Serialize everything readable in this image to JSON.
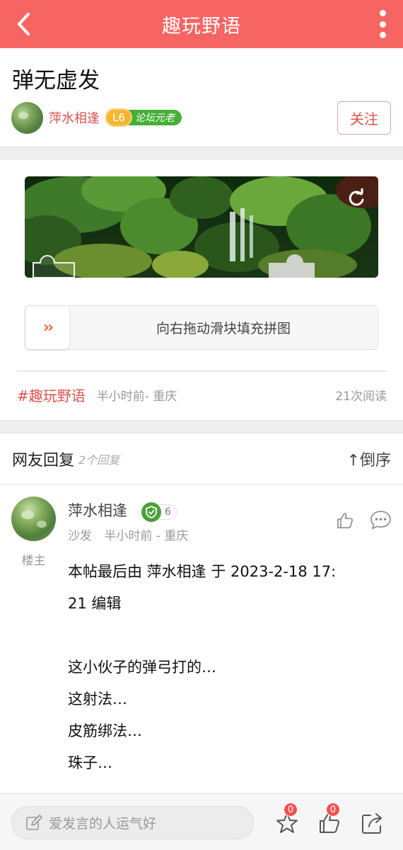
{
  "topbar": {
    "title": "趣玩野语",
    "back_icon": "chevron-left-icon",
    "more_icon": "more-vertical-icon",
    "background_color": "#f76563"
  },
  "post": {
    "title": "弹无虚发",
    "author": "萍水相逢",
    "level": "L6",
    "rank": "论坛元老",
    "follow_label": "关注"
  },
  "captcha": {
    "slider_hint": "向右拖动滑块填充拼图",
    "handle_glyph": "››",
    "refresh_icon": "refresh-icon"
  },
  "meta": {
    "tag": "#趣玩野语",
    "time_location": "半小时前- 重庆",
    "reads": "21次阅读"
  },
  "replies": {
    "header": "网友回复",
    "count": "2个回复",
    "order_label": "↑倒序"
  },
  "reply": {
    "name": "萍水相逢",
    "badge_num": "6",
    "floor": "沙发",
    "time_location": "半小时前 - 重庆",
    "owner_label": "楼主",
    "body": [
      "本帖最后由 萍水相逢 于 2023-2-18 17:",
      "21 编辑",
      "",
      "这小伙子的弹弓打的…",
      "这射法…",
      "皮筋绑法…",
      "珠子…"
    ]
  },
  "bottombar": {
    "comment_placeholder": "爱发言的人运气好",
    "favorite_count": "0",
    "like_count": "0"
  }
}
